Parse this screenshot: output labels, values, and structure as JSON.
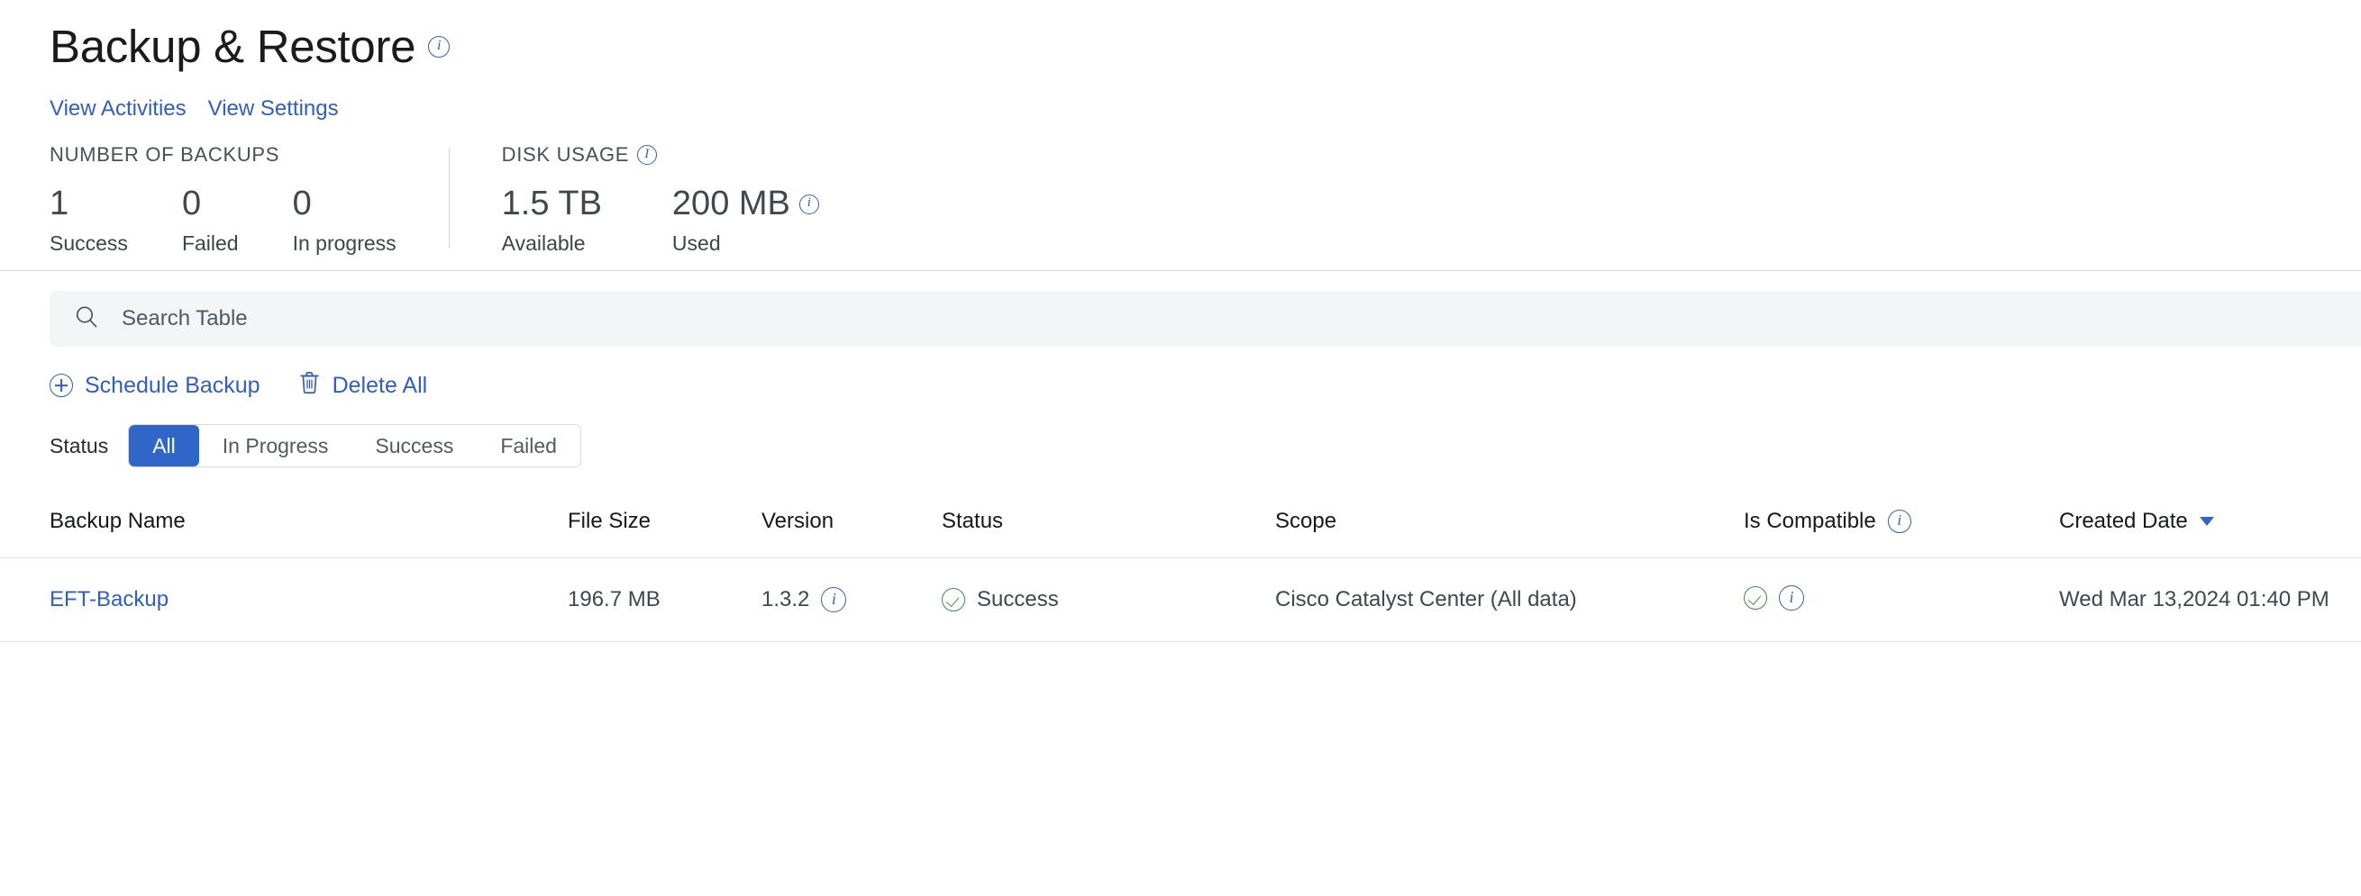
{
  "header": {
    "title": "Backup & Restore",
    "title_info_icon": "info-icon"
  },
  "quick_links": [
    {
      "label": "View Activities",
      "name": "view-activities"
    },
    {
      "label": "View Settings",
      "name": "view-settings"
    }
  ],
  "stats": {
    "backups": {
      "title": "NUMBER OF BACKUPS",
      "items": [
        {
          "value": "1",
          "label": "Success"
        },
        {
          "value": "0",
          "label": "Failed"
        },
        {
          "value": "0",
          "label": "In progress"
        }
      ]
    },
    "disk": {
      "title": "DISK USAGE",
      "items": [
        {
          "value": "1.5 TB",
          "label": "Available"
        },
        {
          "value": "200 MB",
          "label": "Used"
        }
      ]
    }
  },
  "search": {
    "placeholder": "Search Table",
    "value": "",
    "icon": "search-icon"
  },
  "actions": {
    "schedule_backup": "Schedule Backup",
    "delete_all": "Delete All"
  },
  "filter": {
    "label": "Status",
    "options": [
      "All",
      "In Progress",
      "Success",
      "Failed"
    ],
    "selected": "All"
  },
  "table": {
    "columns": [
      {
        "key": "backup_name",
        "label": "Backup Name"
      },
      {
        "key": "file_size",
        "label": "File Size"
      },
      {
        "key": "version",
        "label": "Version"
      },
      {
        "key": "status",
        "label": "Status"
      },
      {
        "key": "scope",
        "label": "Scope"
      },
      {
        "key": "is_compatible",
        "label": "Is Compatible"
      },
      {
        "key": "created_date",
        "label": "Created Date"
      }
    ],
    "sort": {
      "column": "Created Date",
      "direction": "desc"
    },
    "rows": [
      {
        "backup_name": "EFT-Backup",
        "file_size": "196.7 MB",
        "version": "1.3.2",
        "status": "Success",
        "scope": "Cisco Catalyst Center (All data)",
        "is_compatible": "compatible",
        "created_date": "Wed Mar 13,2024 01:40 PM"
      }
    ]
  },
  "colors": {
    "link_blue": "#2f5fc4",
    "accent_blue": "#2f66c8",
    "success_green": "#3a9245",
    "search_bg": "#f3f5f7",
    "rule": "#e2e4e8"
  }
}
